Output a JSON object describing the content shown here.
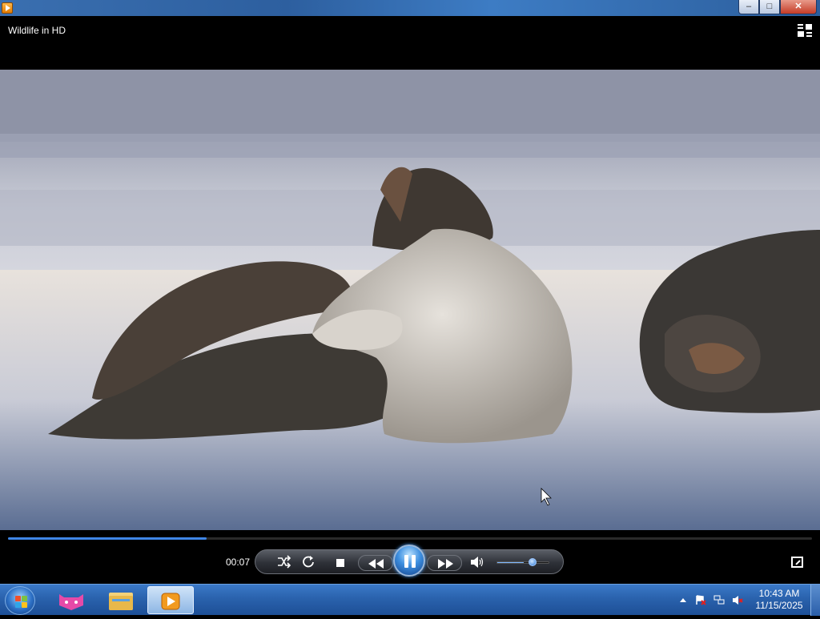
{
  "window": {
    "controls": {
      "minimize": "–",
      "maximize": "□",
      "close": "✕"
    }
  },
  "player": {
    "title": "Wildlife in HD",
    "elapsed": "00:07",
    "progress_fraction": 0.247,
    "volume_fraction": 0.5,
    "icons": {
      "shuffle": "shuffle-icon",
      "repeat": "repeat-icon",
      "stop": "stop-icon",
      "previous": "previous-icon",
      "pause": "pause-icon",
      "next": "next-icon",
      "mute": "speaker-icon",
      "switch_view": "switch-to-library-icon",
      "fullscreen": "fullscreen-icon"
    },
    "accent_color": "#3f86e6"
  },
  "taskbar": {
    "apps": [
      "start-orb",
      "cat-app-icon",
      "file-explorer-icon",
      "media-player-icon"
    ],
    "clock_time": "10:43 AM",
    "clock_date": "11/15/2025"
  }
}
